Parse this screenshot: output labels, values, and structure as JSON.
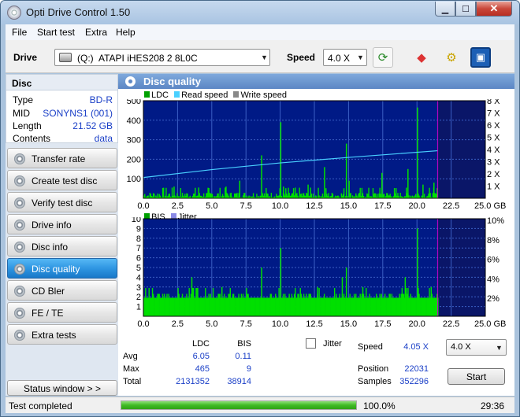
{
  "window": {
    "title": "Opti Drive Control 1.50"
  },
  "menu": [
    "File",
    "Start test",
    "Extra",
    "Help"
  ],
  "toolbar": {
    "drive_label": "Drive",
    "drive_letter": "(Q:)",
    "drive_name": "ATAPI  iHES208   2 8L0C",
    "speed_label": "Speed",
    "speed_value": "4.0 X"
  },
  "disc": {
    "header": "Disc",
    "rows": [
      {
        "key": "Type",
        "value": "BD-R"
      },
      {
        "key": "MID",
        "value": "SONYNS1 (001)"
      },
      {
        "key": "Length",
        "value": "21.52 GB"
      },
      {
        "key": "Contents",
        "value": "data"
      }
    ]
  },
  "nav": [
    {
      "label": "Transfer rate",
      "active": false
    },
    {
      "label": "Create test disc",
      "active": false
    },
    {
      "label": "Verify test disc",
      "active": false
    },
    {
      "label": "Drive info",
      "active": false
    },
    {
      "label": "Disc info",
      "active": false
    },
    {
      "label": "Disc quality",
      "active": true
    },
    {
      "label": "CD Bler",
      "active": false
    },
    {
      "label": "FE / TE",
      "active": false
    },
    {
      "label": "Extra tests",
      "active": false
    }
  ],
  "status_window_label": "Status window > >",
  "panel": {
    "title": "Disc quality"
  },
  "colors": {
    "plot_bg": "#001a86",
    "grid": "#3b5fc4",
    "ldc_bar": "#00e000",
    "read_speed": "#49d0ff",
    "write_speed": "#888888",
    "bis_bar": "#00e000",
    "jitter": "#8a8ae6",
    "marker": "#c800c8"
  },
  "chart_data": [
    {
      "type": "bar",
      "series": [
        {
          "name": "LDC",
          "color": "#00e000"
        },
        {
          "name": "Read speed",
          "color": "#49d0ff"
        },
        {
          "name": "Write speed",
          "color": "#888888"
        }
      ],
      "xlim": [
        0,
        25
      ],
      "xticks": [
        "0.0",
        "2.5",
        "5.0",
        "7.5",
        "10.0",
        "12.5",
        "15.0",
        "17.5",
        "20.0",
        "22.5",
        "25.0 GB"
      ],
      "ylim": [
        0,
        500
      ],
      "yticks": [
        "100",
        "200",
        "300",
        "400",
        "500"
      ],
      "y2lim": [
        0,
        8
      ],
      "y2ticks": [
        "1 X",
        "2 X",
        "3 X",
        "4 X",
        "5 X",
        "6 X",
        "7 X",
        "8 X"
      ],
      "disc_end_gb": 21.52,
      "ldc_spikes": [
        [
          2.2,
          60
        ],
        [
          4.0,
          55
        ],
        [
          6.0,
          60
        ],
        [
          7.0,
          90
        ],
        [
          8.6,
          220
        ],
        [
          10.0,
          390
        ],
        [
          10.2,
          60
        ],
        [
          12.0,
          70
        ],
        [
          13.2,
          160
        ],
        [
          14.8,
          280
        ],
        [
          15.0,
          90
        ],
        [
          17.4,
          130
        ],
        [
          19.3,
          150
        ],
        [
          20.0,
          465
        ],
        [
          20.4,
          70
        ],
        [
          21.2,
          80
        ]
      ],
      "read_speed": [
        [
          0,
          1.7
        ],
        [
          5,
          2.35
        ],
        [
          10,
          2.9
        ],
        [
          15,
          3.35
        ],
        [
          21.52,
          3.9
        ]
      ],
      "grid": true
    },
    {
      "type": "bar",
      "series": [
        {
          "name": "BIS",
          "color": "#00e000"
        },
        {
          "name": "Jitter",
          "color": "#8a8ae6"
        }
      ],
      "xlim": [
        0,
        25
      ],
      "xticks": [
        "0.0",
        "2.5",
        "5.0",
        "7.5",
        "10.0",
        "12.5",
        "15.0",
        "17.5",
        "20.0",
        "22.5",
        "25.0 GB"
      ],
      "ylim": [
        0,
        10
      ],
      "yticks": [
        "1",
        "2",
        "3",
        "4",
        "5",
        "6",
        "7",
        "8",
        "9",
        "10"
      ],
      "y2ticks": [
        "2%",
        "4%",
        "6%",
        "8%",
        "10%"
      ],
      "disc_end_gb": 21.52,
      "bis_baseline": 2,
      "bis_spikes": [
        [
          3.5,
          4
        ],
        [
          5.7,
          3
        ],
        [
          8.6,
          5
        ],
        [
          10.0,
          7
        ],
        [
          12.7,
          3
        ],
        [
          14.5,
          4
        ],
        [
          14.8,
          5
        ],
        [
          16.0,
          3
        ],
        [
          19.1,
          4
        ],
        [
          20.0,
          9
        ],
        [
          21.0,
          3
        ]
      ],
      "grid": true
    }
  ],
  "stats": {
    "col_ldc": "LDC",
    "col_bis": "BIS",
    "avg_label": "Avg",
    "avg_ldc": "6.05",
    "avg_bis": "0.11",
    "max_label": "Max",
    "max_ldc": "465",
    "max_bis": "9",
    "total_label": "Total",
    "total_ldc": "2131352",
    "total_bis": "38914",
    "jitter_label": "Jitter",
    "speed_label": "Speed",
    "speed_value": "4.05 X",
    "position_label": "Position",
    "position_value": "22031",
    "samples_label": "Samples",
    "samples_value": "352296",
    "speed_select": "4.0 X",
    "start_label": "Start"
  },
  "statusbar": {
    "text": "Test completed",
    "progress": 100,
    "progress_text": "100.0%",
    "time": "29:36"
  }
}
